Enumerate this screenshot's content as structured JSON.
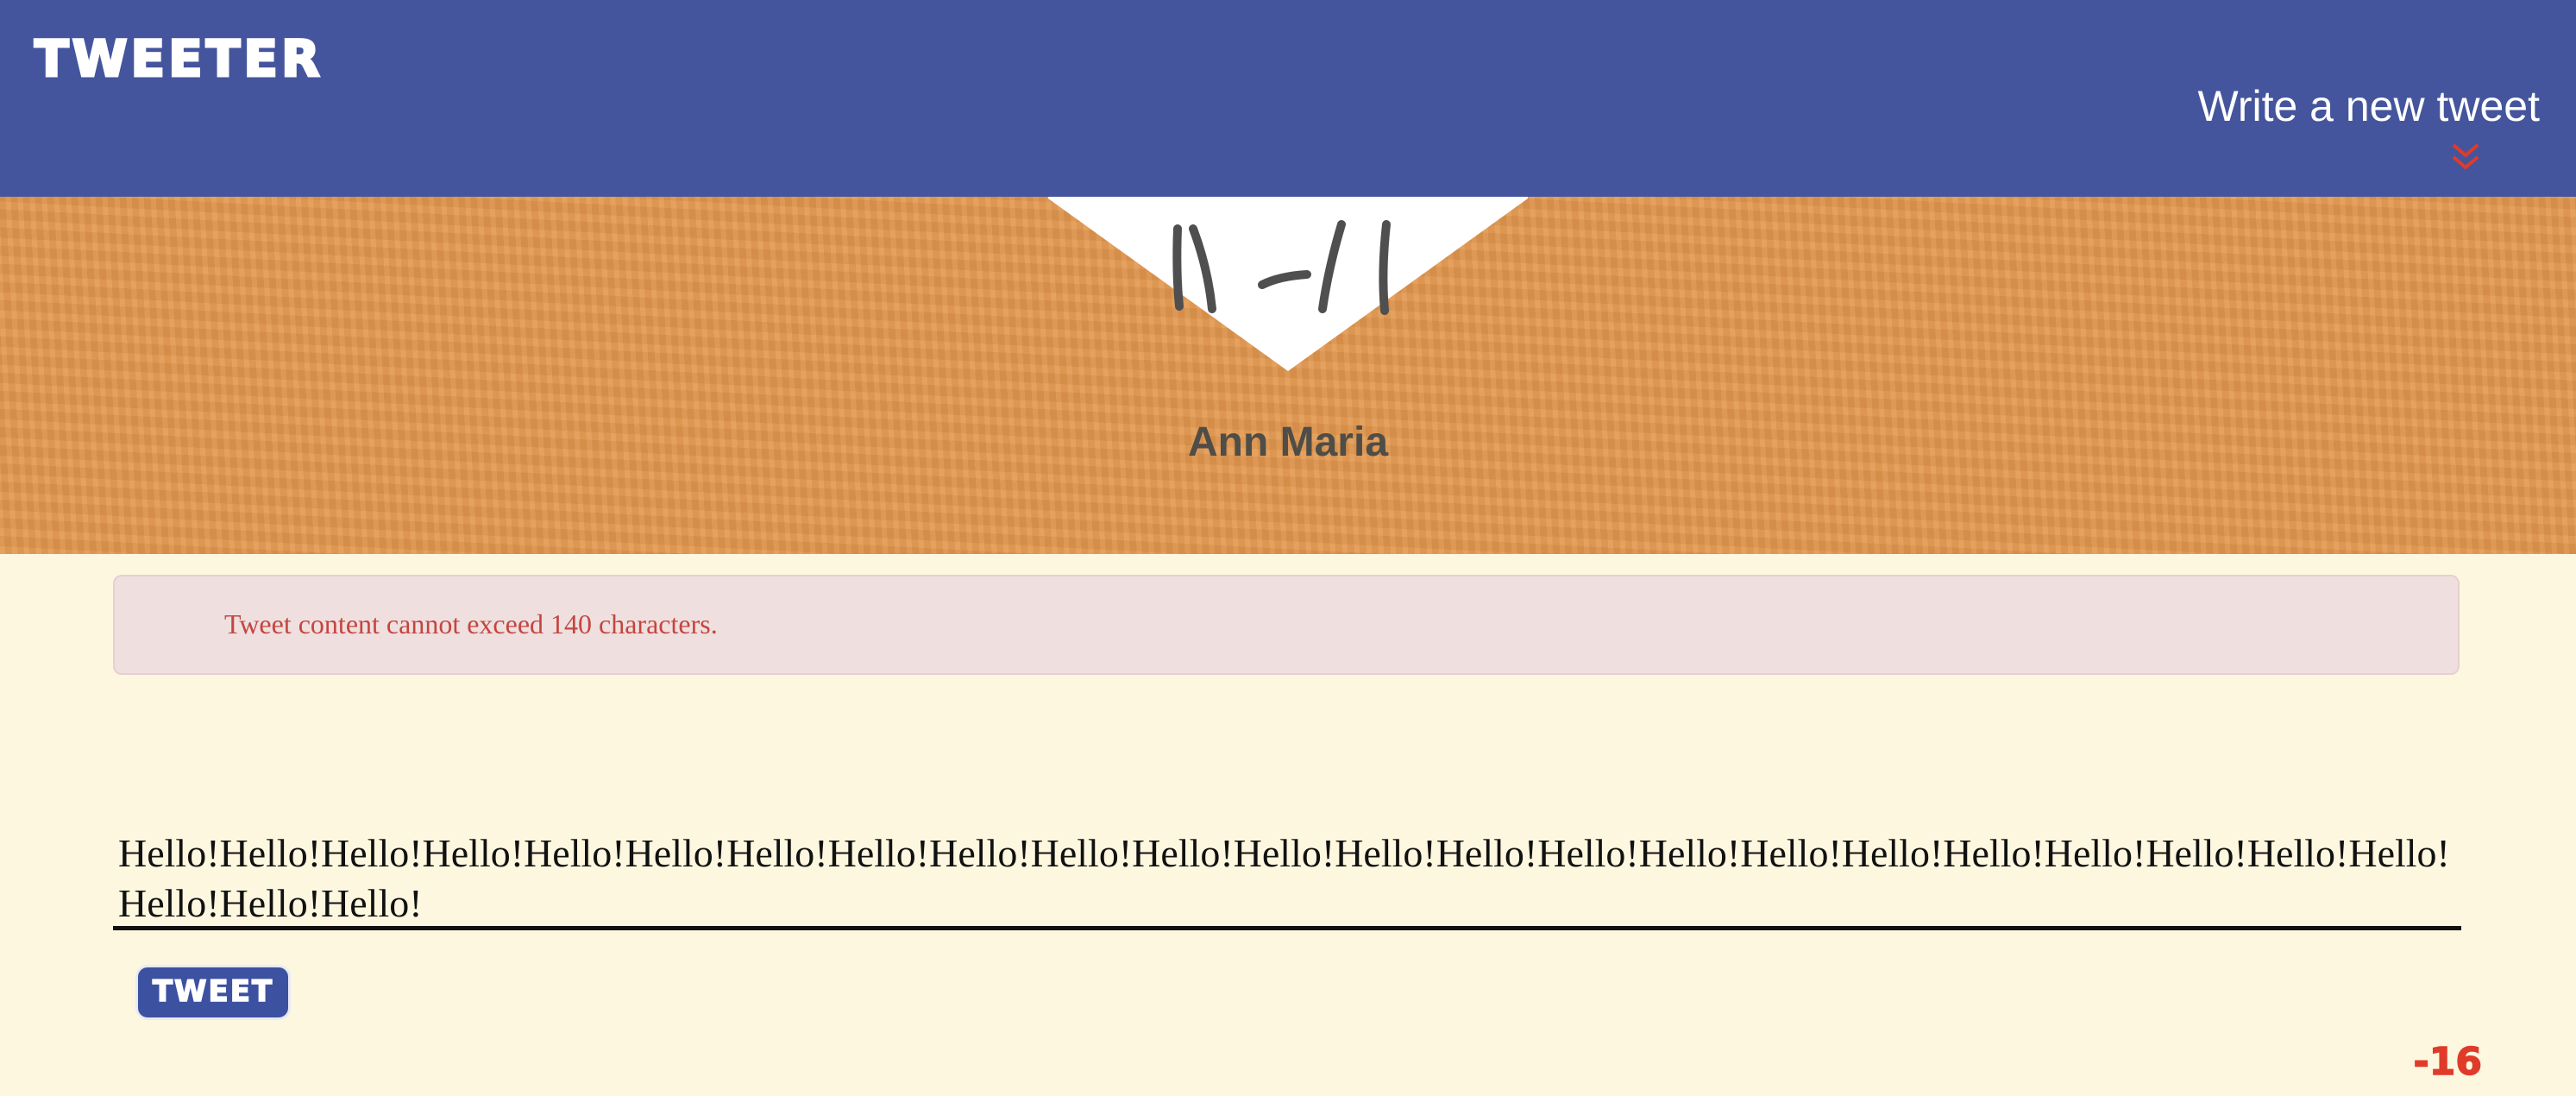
{
  "navbar": {
    "brand": "TWEETER",
    "compose_toggle_label": "Write a new tweet",
    "compose_toggle_icon": "double-chevron-down-icon"
  },
  "profile": {
    "avatar_icon": "face-avatar-icon",
    "name": "Ann Maria"
  },
  "error": {
    "message": "Tweet content cannot exceed 140 characters."
  },
  "compose": {
    "text": "Hello!Hello!Hello!Hello!Hello!Hello!Hello!Hello!Hello!Hello!Hello!Hello!Hello!Hello!Hello!Hello!Hello!Hello!Hello!Hello!Hello!Hello!Hello!Hello!Hello!Hello!",
    "submit_label": "TWEET",
    "char_counter": "-16"
  },
  "colors": {
    "navbar": "#44559d",
    "banner": "#e3984f",
    "page_background": "#fdf7df",
    "error_background": "#efdfdf",
    "error_text": "#c4453f",
    "counter_over_limit": "#e03b2a",
    "chevron": "#e03b2a"
  }
}
